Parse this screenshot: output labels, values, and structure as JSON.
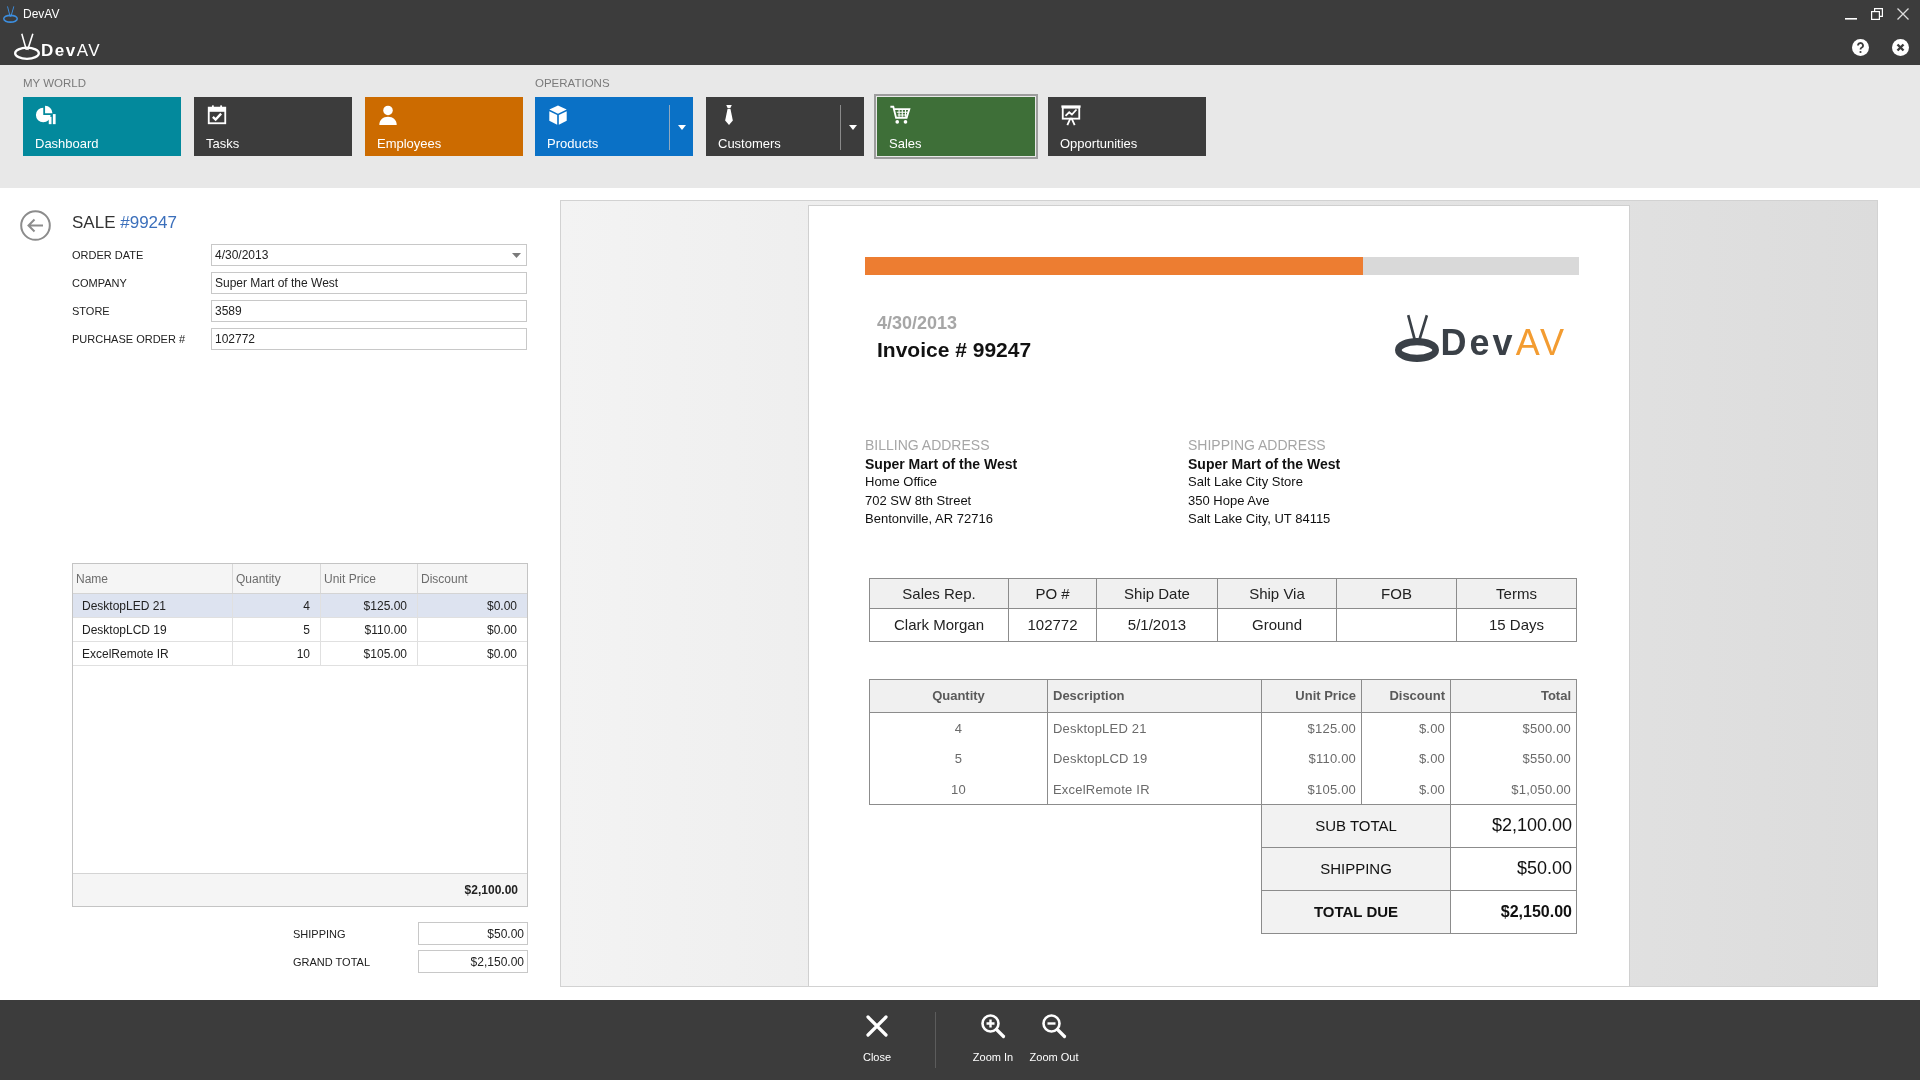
{
  "window": {
    "title": "DevAV"
  },
  "app_header": {
    "logo": {
      "text": "Dev",
      "accent": "AV"
    }
  },
  "ribbon": {
    "groups": [
      {
        "label": "MY WORLD",
        "tiles": [
          {
            "label": "Dashboard",
            "color": "#03899c",
            "selected": false,
            "dropdown": false
          },
          {
            "label": "Tasks",
            "color": "#3c3c3c",
            "selected": false,
            "dropdown": false
          },
          {
            "label": "Employees",
            "color": "#cc6b00",
            "selected": false,
            "dropdown": false
          }
        ]
      },
      {
        "label": "OPERATIONS",
        "tiles": [
          {
            "label": "Products",
            "color": "#0a71c6",
            "selected": false,
            "dropdown": true
          },
          {
            "label": "Customers",
            "color": "#3c3c3c",
            "selected": false,
            "dropdown": true
          },
          {
            "label": "Sales",
            "color": "#3e6f38",
            "selected": true,
            "dropdown": false
          },
          {
            "label": "Opportunities",
            "color": "#3c3c3c",
            "selected": false,
            "dropdown": false
          }
        ]
      }
    ]
  },
  "sale": {
    "title": "SALE",
    "number": "#99247",
    "fields": [
      {
        "label": "ORDER DATE",
        "value": "4/30/2013",
        "kind": "dropdown"
      },
      {
        "label": "COMPANY",
        "value": "Super Mart of the West",
        "kind": "text"
      },
      {
        "label": "STORE",
        "value": "3589",
        "kind": "text"
      },
      {
        "label": "PURCHASE ORDER #",
        "value": "102772",
        "kind": "text"
      }
    ]
  },
  "items_grid": {
    "columns": [
      "Name",
      "Quantity",
      "Unit Price",
      "Discount"
    ],
    "rows": [
      {
        "cells": [
          "DesktopLED 21",
          "4",
          "$125.00",
          "$0.00"
        ],
        "selected": true
      },
      {
        "cells": [
          "DesktopLCD 19",
          "5",
          "$110.00",
          "$0.00"
        ],
        "selected": false
      },
      {
        "cells": [
          "ExcelRemote IR",
          "10",
          "$105.00",
          "$0.00"
        ],
        "selected": false
      }
    ],
    "total": "$2,100.00"
  },
  "summary": [
    {
      "label": "SHIPPING",
      "value": "$50.00"
    },
    {
      "label": "GRAND TOTAL",
      "value": "$2,150.00"
    }
  ],
  "invoice": {
    "date": "4/30/2013",
    "title": "Invoice # 99247",
    "logo": {
      "text": "Dev",
      "accent": "AV"
    },
    "billing": {
      "label": "BILLING ADDRESS",
      "name": "Super Mart of the West",
      "lines": [
        "Home Office",
        "702 SW 8th Street",
        "Bentonville, AR 72716"
      ]
    },
    "shipping": {
      "label": "SHIPPING ADDRESS",
      "name": "Super Mart of the West",
      "lines": [
        "Salt Lake City Store",
        "350 Hope Ave",
        "Salt Lake City, UT 84115"
      ]
    },
    "info_table": [
      {
        "heading": "Sales Rep.",
        "value": "Clark Morgan"
      },
      {
        "heading": "PO #",
        "value": "102772"
      },
      {
        "heading": "Ship Date",
        "value": "5/1/2013"
      },
      {
        "heading": "Ship Via",
        "value": "Ground"
      },
      {
        "heading": "FOB"
      },
      {
        "heading": "Terms",
        "value": "15 Days"
      }
    ],
    "lines_table": {
      "columns": [
        "Quantity",
        "Description",
        "Unit Price",
        "Discount",
        "Total"
      ],
      "rows": [
        [
          "4",
          "DesktopLED 21",
          "$125.00",
          "$.00",
          "$500.00"
        ],
        [
          "5",
          "DesktopLCD 19",
          "$110.00",
          "$.00",
          "$550.00"
        ],
        [
          "10",
          "ExcelRemote IR",
          "$105.00",
          "$.00",
          "$1,050.00"
        ]
      ]
    },
    "totals": [
      {
        "label": "SUB TOTAL",
        "value": "$2,100.00",
        "emphasized": false
      },
      {
        "label": "SHIPPING",
        "value": "$50.00",
        "emphasized": false
      },
      {
        "label": "TOTAL DUE",
        "value": "$2,150.00",
        "emphasized": true
      }
    ]
  },
  "actions": [
    {
      "label": "Close"
    },
    {
      "label": "Zoom In"
    },
    {
      "label": "Zoom Out"
    }
  ]
}
